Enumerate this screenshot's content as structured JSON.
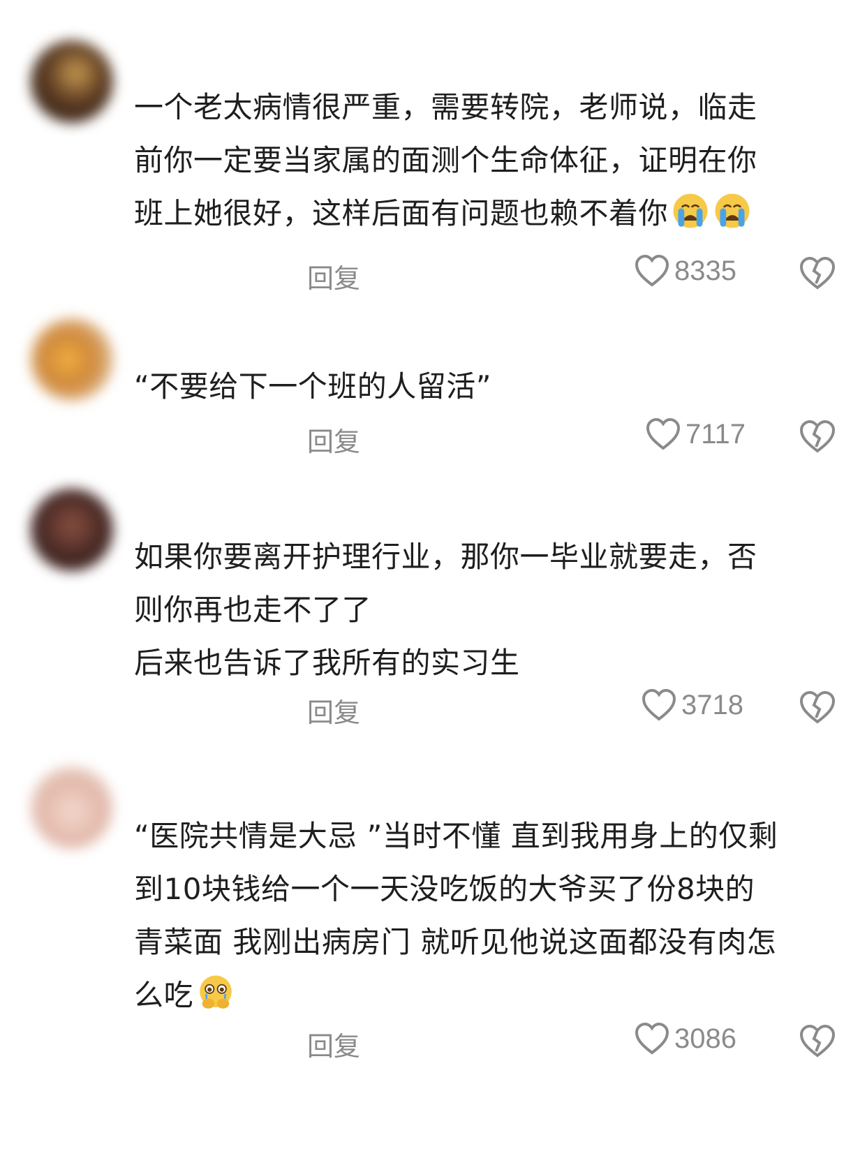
{
  "comments": [
    {
      "avatar_color": "#3b2a1e",
      "lines": [
        "一个老太病情很严重，需要转院，老师说，临走",
        "前你一定要当家属的面测个生命体征，证明在你",
        "班上她很好，这样后面有问题也赖不着你"
      ],
      "emoji": "loudly-crying-face-emoji",
      "emoji_count": 2,
      "reply_label": "回复",
      "like_count": "8335"
    },
    {
      "avatar_color": "#d99a3a",
      "lines": [
        "“不要给下一个班的人留活”"
      ],
      "reply_label": "回复",
      "like_count": "7117"
    },
    {
      "avatar_color": "#6a3a30",
      "lines": [
        "如果你要离开护理行业，那你一毕业就要走，否",
        "则你再也走不了了",
        "后来也告诉了我所有的实习生"
      ],
      "reply_label": "回复",
      "like_count": "3718"
    },
    {
      "avatar_color": "#e8c2b8",
      "lines": [
        "“医院共情是大忌 ”当时不懂 直到我用身上的仅剩",
        "到10块钱给一个一天没吃饭的大爷买了份8块的",
        "青菜面 我刚出病房门 就听见他说这面都没有肉怎",
        "么吃"
      ],
      "emoji": "face-holding-back-tears-emoji",
      "emoji_count": 1,
      "reply_label": "回复",
      "like_count": "3086"
    }
  ],
  "icons": {
    "like": "heart-outline-icon",
    "dislike": "broken-heart-icon"
  },
  "colors": {
    "text": "#1e1e1e",
    "meta": "#8a8a8a",
    "emoji_yellow": "#f7c948",
    "tear_blue": "#4aa3e8"
  }
}
